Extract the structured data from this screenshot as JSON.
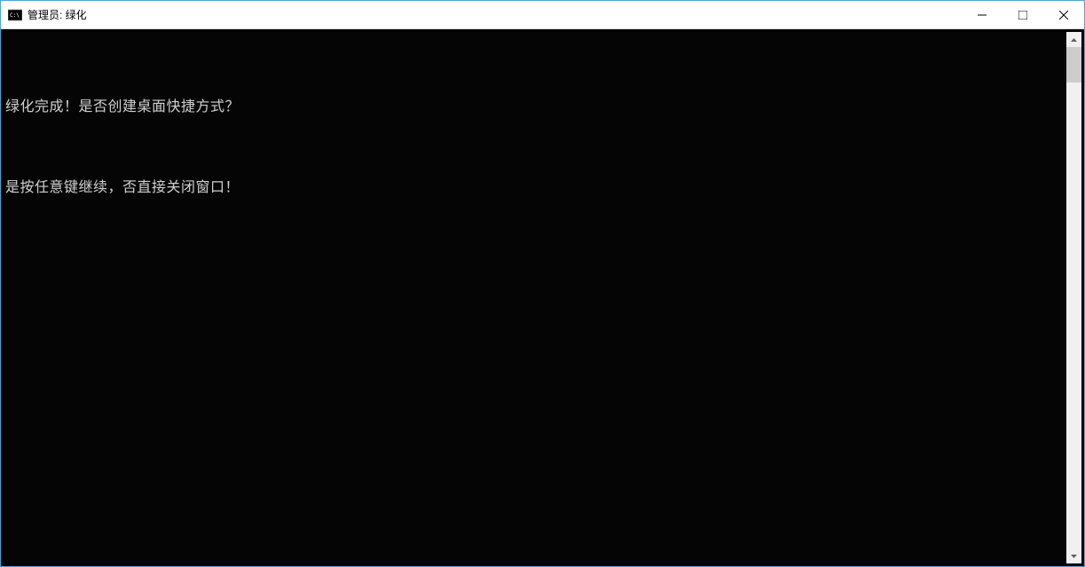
{
  "window": {
    "title": "管理员: 绿化"
  },
  "console": {
    "lines": [
      "绿化完成！是否创建桌面快捷方式？",
      "是按任意键继续，否直接关闭窗口！"
    ]
  }
}
